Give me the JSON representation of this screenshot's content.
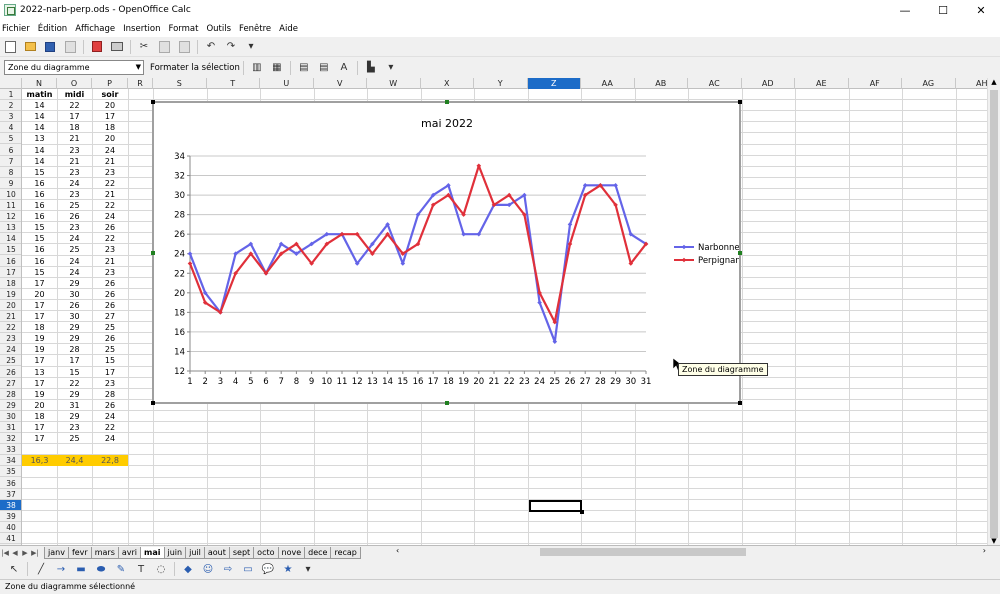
{
  "window": {
    "title": "2022-narb-perp.ods - OpenOffice Calc",
    "minimize": "—",
    "maximize": "☐",
    "close": "✕"
  },
  "menu": [
    "Fichier",
    "Édition",
    "Affichage",
    "Insertion",
    "Format",
    "Outils",
    "Fenêtre",
    "Aide"
  ],
  "toolbar2": {
    "namebox": "Zone du diagramme",
    "format_selection": "Formater la sélection"
  },
  "columns": {
    "left": [
      "N",
      "O",
      "P"
    ],
    "right": [
      "R",
      "S",
      "T",
      "U",
      "V",
      "W",
      "X",
      "Y",
      "Z",
      "AA",
      "AB",
      "AC",
      "AD",
      "AE",
      "AF",
      "AG",
      "AH"
    ],
    "selected": "Z"
  },
  "rows": {
    "first": 1,
    "last": 41,
    "selected": 38
  },
  "sheet": {
    "headers": [
      "matin",
      "midi",
      "soir"
    ],
    "data": [
      [
        14,
        22,
        20
      ],
      [
        14,
        17,
        17
      ],
      [
        14,
        18,
        18
      ],
      [
        13,
        21,
        20
      ],
      [
        14,
        23,
        24
      ],
      [
        14,
        21,
        21
      ],
      [
        15,
        23,
        23
      ],
      [
        16,
        24,
        22
      ],
      [
        16,
        23,
        21
      ],
      [
        16,
        25,
        22
      ],
      [
        16,
        26,
        24
      ],
      [
        15,
        23,
        26
      ],
      [
        15,
        24,
        22
      ],
      [
        16,
        25,
        23
      ],
      [
        16,
        24,
        21
      ],
      [
        15,
        24,
        23
      ],
      [
        17,
        29,
        26
      ],
      [
        20,
        30,
        26
      ],
      [
        17,
        26,
        26
      ],
      [
        17,
        30,
        27
      ],
      [
        18,
        29,
        25
      ],
      [
        19,
        29,
        26
      ],
      [
        19,
        28,
        25
      ],
      [
        17,
        17,
        15
      ],
      [
        13,
        15,
        17
      ],
      [
        17,
        22,
        23
      ],
      [
        19,
        29,
        28
      ],
      [
        20,
        31,
        26
      ],
      [
        18,
        29,
        24
      ],
      [
        17,
        23,
        22
      ],
      [
        17,
        25,
        24
      ]
    ],
    "averages": [
      "16,3",
      "24,4",
      "22,8"
    ]
  },
  "chart_data": {
    "type": "line",
    "title": "mai 2022",
    "x": [
      1,
      2,
      3,
      4,
      5,
      6,
      7,
      8,
      9,
      10,
      11,
      12,
      13,
      14,
      15,
      16,
      17,
      18,
      19,
      20,
      21,
      22,
      23,
      24,
      25,
      26,
      27,
      28,
      29,
      30,
      31
    ],
    "series": [
      {
        "name": "Narbonne",
        "color": "#6464e8",
        "values": [
          24,
          20,
          18,
          24,
          25,
          22,
          25,
          24,
          25,
          26,
          26,
          23,
          25,
          27,
          23,
          28,
          30,
          31,
          26,
          26,
          29,
          29,
          30,
          19,
          15,
          27,
          31,
          31,
          31,
          26,
          25
        ]
      },
      {
        "name": "Perpignan",
        "color": "#e0303a",
        "values": [
          23,
          19,
          18,
          22,
          24,
          22,
          24,
          25,
          23,
          25,
          26,
          26,
          24,
          26,
          24,
          25,
          29,
          30,
          28,
          33,
          29,
          30,
          28,
          20,
          17,
          25,
          30,
          31,
          29,
          23,
          25
        ]
      }
    ],
    "ylim": [
      12,
      34
    ],
    "yticks": [
      12,
      14,
      16,
      18,
      20,
      22,
      24,
      26,
      28,
      30,
      32,
      34
    ],
    "grid": true,
    "legend": "right"
  },
  "tooltip": "Zone du diagramme",
  "tabs": [
    "janv",
    "fevr",
    "mars",
    "avri",
    "mai",
    "juin",
    "juil",
    "aout",
    "sept",
    "octo",
    "nove",
    "dece",
    "recap"
  ],
  "active_tab": "mai",
  "status": "Zone du diagramme sélectionné"
}
